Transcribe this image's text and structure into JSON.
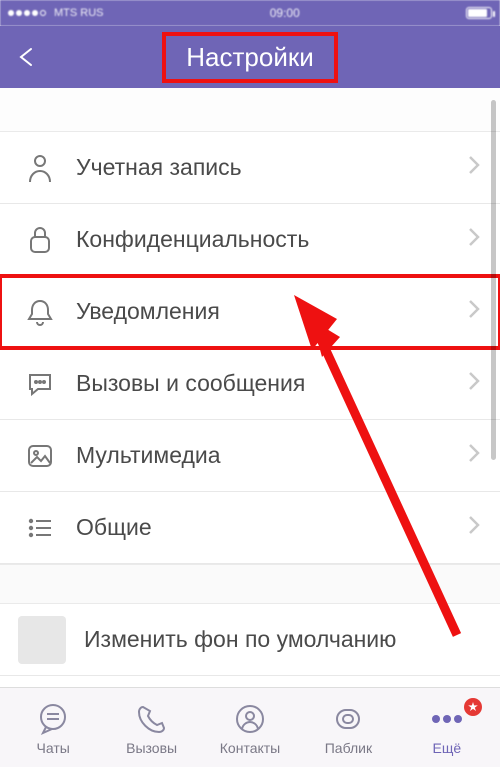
{
  "statusbar": {
    "carrier": "MTS RUS",
    "time": "09:00"
  },
  "header": {
    "title": "Настройки"
  },
  "settings": {
    "items": [
      {
        "label": "Учетная запись"
      },
      {
        "label": "Конфиденциальность"
      },
      {
        "label": "Уведомления"
      },
      {
        "label": "Вызовы и сообщения"
      },
      {
        "label": "Мультимедиа"
      },
      {
        "label": "Общие"
      }
    ],
    "background_row": {
      "label": "Изменить фон по умолчанию"
    }
  },
  "tabs": {
    "items": [
      {
        "label": "Чаты"
      },
      {
        "label": "Вызовы"
      },
      {
        "label": "Контакты"
      },
      {
        "label": "Паблик"
      },
      {
        "label": "Ещё"
      }
    ]
  },
  "colors": {
    "brand": "#6f65b6",
    "highlight": "#e11"
  }
}
